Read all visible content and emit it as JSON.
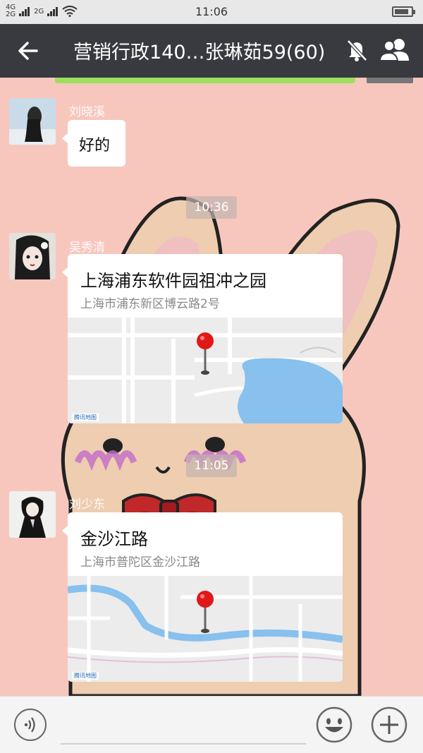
{
  "status_bar": {
    "network1": "4G",
    "network2": "2G",
    "network3": "2G",
    "time": "11:06",
    "battery_level": 0.85
  },
  "header": {
    "title": "营销行政140…张琳茹59(60)",
    "icons": [
      "back-arrow-icon",
      "mute-bell-icon",
      "group-members-icon"
    ]
  },
  "messages": [
    {
      "type": "text",
      "sender": "刘晓溪",
      "text": "好的"
    },
    {
      "type": "time",
      "text": "10:36"
    },
    {
      "type": "location",
      "sender": "吴秀清",
      "place": "上海浦东软件园祖冲之园",
      "address": "上海市浦东新区博云路2号",
      "map_watermark": "腾讯地图"
    },
    {
      "type": "time",
      "text": "11:05"
    },
    {
      "type": "location",
      "sender": "刘少东",
      "place": "金沙江路",
      "address": "上海市普陀区金沙江路",
      "map_watermark": "腾讯地图"
    }
  ],
  "input_bar": {
    "icons": [
      "voice-icon",
      "emoji-icon",
      "plus-icon"
    ]
  },
  "colors": {
    "chat_background": "#f7c7be",
    "title_bar": "#393a3f",
    "pin": "#e01818",
    "map_water": "#88c0ee"
  }
}
